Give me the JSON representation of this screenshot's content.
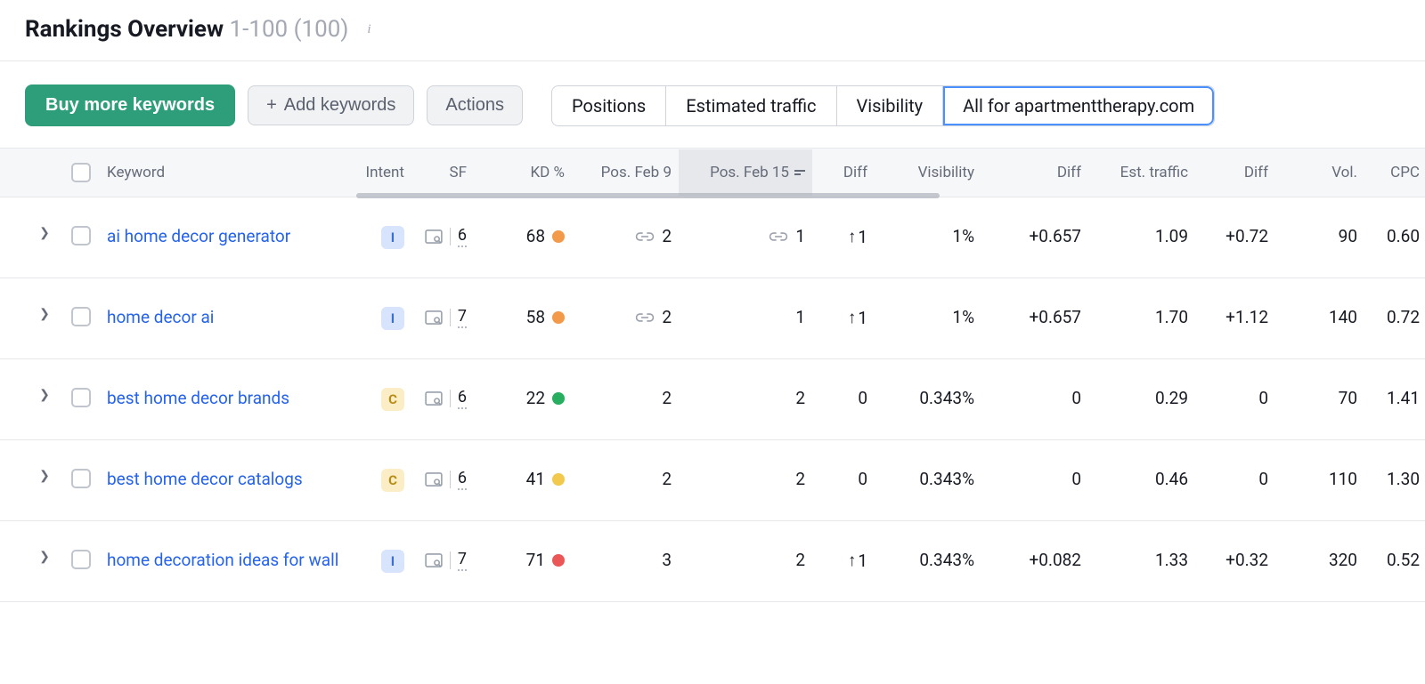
{
  "header": {
    "title": "Rankings Overview",
    "range": "1-100 (100)"
  },
  "toolbar": {
    "buy": "Buy more keywords",
    "add": "Add keywords",
    "actions": "Actions",
    "tabs": [
      "Positions",
      "Estimated traffic",
      "Visibility",
      "All for apartmenttherapy.com"
    ],
    "active_tab": 3
  },
  "columns": {
    "keyword": "Keyword",
    "intent": "Intent",
    "sf": "SF",
    "kd": "KD %",
    "pos_prev": "Pos. Feb 9",
    "pos_cur": "Pos. Feb 15",
    "diff_pos": "Diff",
    "visibility": "Visibility",
    "diff_vis": "Diff",
    "est_traffic": "Est. traffic",
    "diff_traf": "Diff",
    "vol": "Vol.",
    "cpc": "CPC"
  },
  "rows": [
    {
      "keyword": "ai home decor generator",
      "intent": "I",
      "sf": "6",
      "kd": "68",
      "kd_color": "orange",
      "pos_prev": "2",
      "pos_prev_link": true,
      "pos_cur": "1",
      "pos_cur_link": true,
      "diff_pos": "1",
      "diff_pos_up": true,
      "visibility": "1%",
      "diff_vis": "+0.657",
      "diff_vis_pos": true,
      "est_traffic": "1.09",
      "diff_traf": "+0.72",
      "diff_traf_pos": true,
      "vol": "90",
      "cpc": "0.60"
    },
    {
      "keyword": "home decor ai",
      "intent": "I",
      "sf": "7",
      "kd": "58",
      "kd_color": "orange",
      "pos_prev": "2",
      "pos_prev_link": true,
      "pos_cur": "1",
      "pos_cur_link": false,
      "diff_pos": "1",
      "diff_pos_up": true,
      "visibility": "1%",
      "diff_vis": "+0.657",
      "diff_vis_pos": true,
      "est_traffic": "1.70",
      "diff_traf": "+1.12",
      "diff_traf_pos": true,
      "vol": "140",
      "cpc": "0.72"
    },
    {
      "keyword": "best home decor brands",
      "intent": "C",
      "sf": "6",
      "kd": "22",
      "kd_color": "green",
      "pos_prev": "2",
      "pos_prev_link": false,
      "pos_cur": "2",
      "pos_cur_link": false,
      "diff_pos": "0",
      "diff_pos_up": false,
      "visibility": "0.343%",
      "diff_vis": "0",
      "diff_vis_pos": false,
      "est_traffic": "0.29",
      "diff_traf": "0",
      "diff_traf_pos": false,
      "vol": "70",
      "cpc": "1.41"
    },
    {
      "keyword": "best home decor catalogs",
      "intent": "C",
      "sf": "6",
      "kd": "41",
      "kd_color": "yellow",
      "pos_prev": "2",
      "pos_prev_link": false,
      "pos_cur": "2",
      "pos_cur_link": false,
      "diff_pos": "0",
      "diff_pos_up": false,
      "visibility": "0.343%",
      "diff_vis": "0",
      "diff_vis_pos": false,
      "est_traffic": "0.46",
      "diff_traf": "0",
      "diff_traf_pos": false,
      "vol": "110",
      "cpc": "1.30"
    },
    {
      "keyword": "home decoration ideas for wall",
      "intent": "I",
      "sf": "7",
      "kd": "71",
      "kd_color": "red",
      "pos_prev": "3",
      "pos_prev_link": false,
      "pos_cur": "2",
      "pos_cur_link": false,
      "diff_pos": "1",
      "diff_pos_up": true,
      "visibility": "0.343%",
      "diff_vis": "+0.082",
      "diff_vis_pos": true,
      "est_traffic": "1.33",
      "diff_traf": "+0.32",
      "diff_traf_pos": true,
      "vol": "320",
      "cpc": "0.52"
    }
  ]
}
